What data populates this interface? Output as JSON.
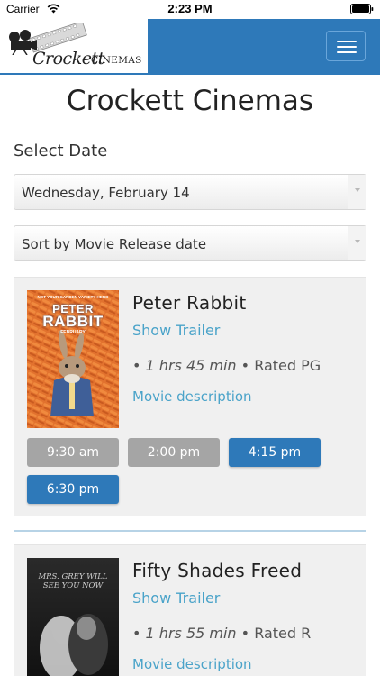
{
  "status_bar": {
    "carrier": "Carrier",
    "time": "2:23 PM"
  },
  "header": {
    "logo_script": "Crockett",
    "logo_word": "CINEMAS",
    "menu_icon": "hamburger-icon",
    "brand_color": "#2e79b9"
  },
  "page_title": "Crockett Cinemas",
  "select_date_label": "Select Date",
  "date_select": {
    "value": "Wednesday, February 14"
  },
  "sort_select": {
    "value": "Sort by Movie Release date"
  },
  "movies": [
    {
      "title": "Peter Rabbit",
      "trailer_label": "Show Trailer",
      "runtime": "1 hrs 45 min",
      "rating": "Rated PG",
      "description_label": "Movie description",
      "poster": {
        "tagline": "NOT YOUR GARDEN VARIETY HERO",
        "title_line1": "PETER",
        "title_line2": "RABBIT",
        "date": "FEBRUARY"
      },
      "showtimes": [
        {
          "time": "9:30 am",
          "available": false
        },
        {
          "time": "2:00 pm",
          "available": false
        },
        {
          "time": "4:15 pm",
          "available": true
        },
        {
          "time": "6:30 pm",
          "available": true
        }
      ]
    },
    {
      "title": "Fifty Shades Freed",
      "trailer_label": "Show Trailer",
      "runtime": "1 hrs 55 min",
      "rating": "Rated R",
      "description_label": "Movie description",
      "poster": {
        "tagline_line1": "MRS. GREY WILL",
        "tagline_line2": "SEE YOU NOW"
      }
    }
  ],
  "colors": {
    "link": "#4aa3c9",
    "button_active": "#2e79b9",
    "button_past": "#a5a5a5",
    "card_bg": "#f0f0f0"
  }
}
